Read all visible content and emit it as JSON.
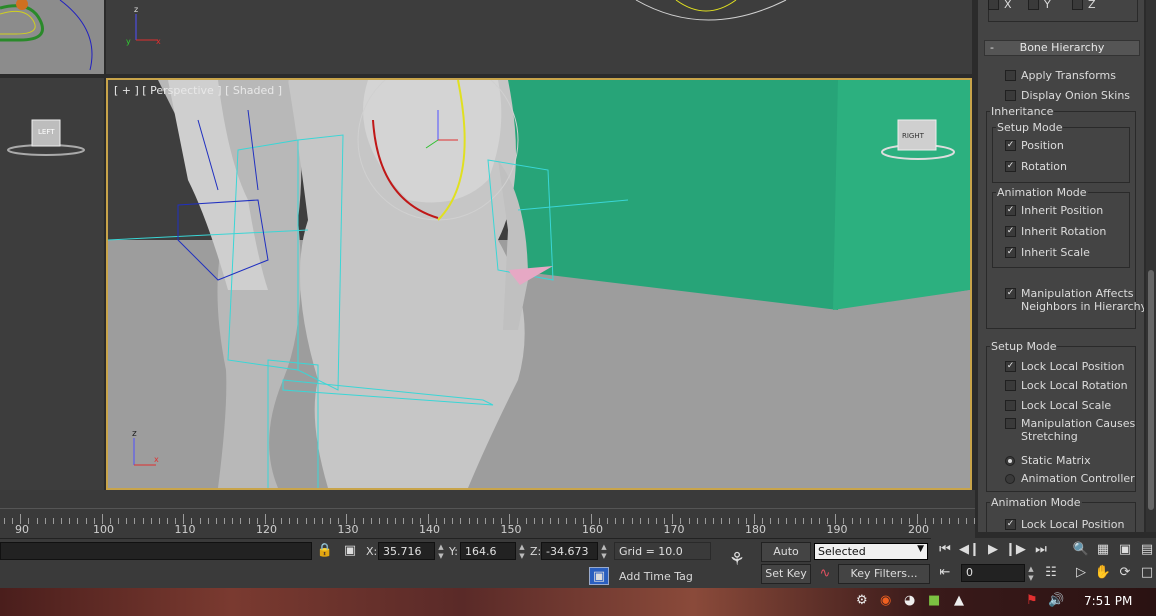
{
  "viewport": {
    "label": "[ + ] [ Perspective ] [ Shaded ]",
    "left_cube_label": "LEFT",
    "right_cube_label": "RIGHT"
  },
  "right_panel": {
    "top_checkboxes": [
      "X",
      "Y",
      "Z"
    ],
    "rollout_title": "Bone Hierarchy",
    "apply_transforms": "Apply Transforms",
    "display_onion_skins": "Display Onion Skins",
    "inheritance_label": "Inheritance",
    "setup_mode_group": "Setup Mode",
    "position": "Position",
    "rotation": "Rotation",
    "animation_mode_group": "Animation Mode",
    "inherit_position": "Inherit Position",
    "inherit_rotation": "Inherit Rotation",
    "inherit_scale": "Inherit Scale",
    "manip_affects_line1": "Manipulation Affects",
    "manip_affects_line2": "Neighbors in Hierarchy",
    "setup_mode_2": "Setup Mode",
    "lock_local_position": "Lock Local Position",
    "lock_local_rotation": "Lock Local Rotation",
    "lock_local_scale": "Lock Local Scale",
    "manip_causes_line1": "Manipulation Causes",
    "manip_causes_line2": "Stretching",
    "static_matrix": "Static Matrix",
    "animation_controller": "Animation Controller",
    "animation_mode_2": "Animation Mode",
    "lock_local_position_2": "Lock Local Position"
  },
  "timeline": {
    "ticks": [
      90,
      100,
      110,
      120,
      130,
      140,
      150,
      160,
      170,
      180,
      190,
      200
    ]
  },
  "status_bar": {
    "x_label": "X:",
    "x_value": "35.716",
    "y_label": "Y:",
    "y_value": "164.6",
    "z_label": "Z:",
    "z_value": "-34.673",
    "grid": "Grid = 10.0",
    "add_time_tag": "Add Time Tag",
    "auto_key": "Auto Key",
    "set_key": "Set Key",
    "selected_option": "Selected",
    "key_filters": "Key Filters...",
    "frame_value": "0"
  },
  "taskbar": {
    "clock": "7:51 PM"
  },
  "colors": {
    "viewport_border": "#c8a44a",
    "green_wall": "#27a478",
    "wire_cyan": "#3ad6d6",
    "wire_blue": "#2030c0"
  }
}
